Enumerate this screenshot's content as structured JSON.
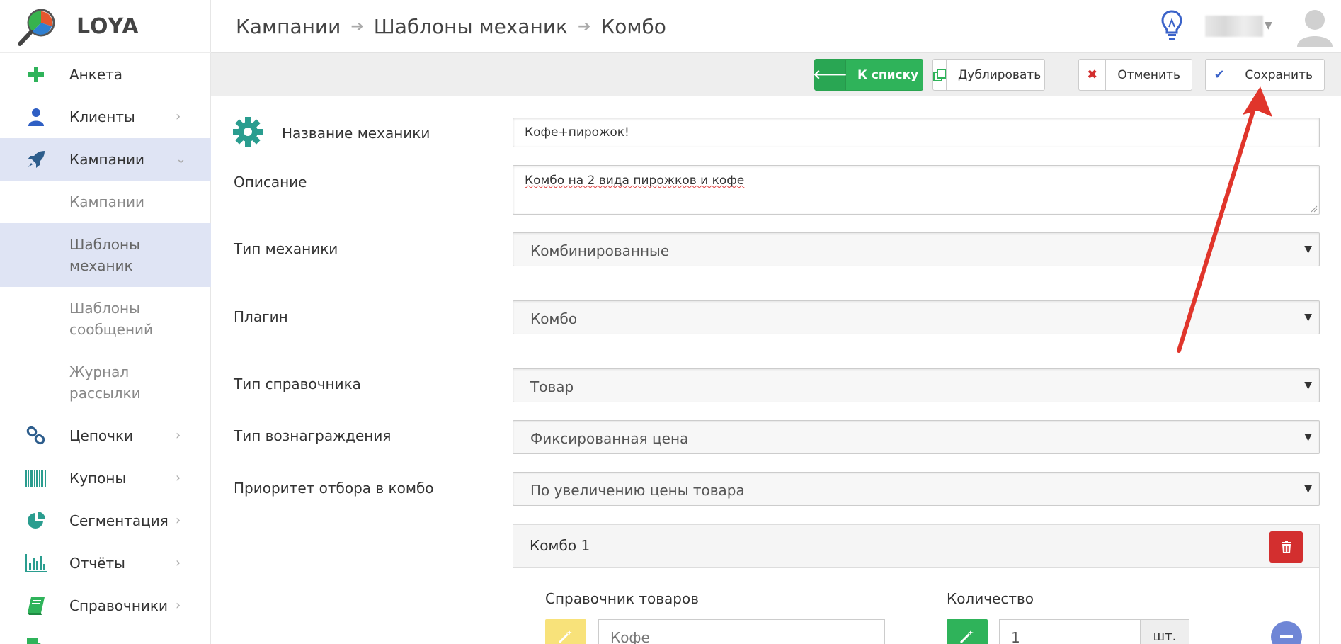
{
  "app": {
    "brand": "LOYA"
  },
  "breadcrumb": {
    "items": [
      "Кампании",
      "Шаблоны механик",
      "Комбо"
    ]
  },
  "sidebar": {
    "items": [
      {
        "label": "Анкета",
        "icon": "plus-icon"
      },
      {
        "label": "Клиенты",
        "icon": "user-icon"
      },
      {
        "label": "Кампании",
        "icon": "rocket-icon"
      },
      {
        "label": "Цепочки",
        "icon": "chain-icon"
      },
      {
        "label": "Купоны",
        "icon": "barcode-icon"
      },
      {
        "label": "Сегментация",
        "icon": "pie-icon"
      },
      {
        "label": "Отчёты",
        "icon": "chart-icon"
      },
      {
        "label": "Справочники",
        "icon": "book-icon"
      }
    ],
    "sub_items": [
      "Кампании",
      "Шаблоны механик",
      "Шаблоны сообщений",
      "Журнал рассылки"
    ]
  },
  "toolbar": {
    "back_label": "К списку",
    "duplicate_label": "Дублировать",
    "cancel_label": "Отменить",
    "save_label": "Сохранить"
  },
  "form": {
    "name_label": "Название механики",
    "name_value": "Кофе+пирожок!",
    "description_label": "Описание",
    "description_value": "Комбо на 2 вида пирожков и кофе",
    "mechanic_type_label": "Тип механики",
    "mechanic_type_value": "Комбинированные",
    "plugin_label": "Плагин",
    "plugin_value": "Комбо",
    "directory_type_label": "Тип справочника",
    "directory_type_value": "Товар",
    "reward_type_label": "Тип вознаграждения",
    "reward_type_value": "Фиксированная цена",
    "priority_label": "Приоритет отбора в комбо",
    "priority_value": "По увеличению цены товара"
  },
  "combo": {
    "title": "Комбо 1",
    "products_label": "Справочник товаров",
    "product_value": "Кофе",
    "quantity_label": "Количество",
    "quantity_value": "1",
    "unit": "шт."
  },
  "colors": {
    "accent_green": "#2fb35a",
    "danger_red": "#d32f2f",
    "active_bg": "#dfe4f4",
    "annotation_arrow": "#e0352b"
  }
}
